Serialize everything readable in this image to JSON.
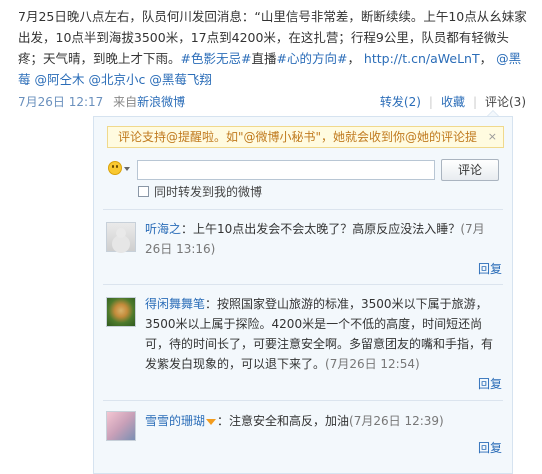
{
  "post": {
    "text_main": "7月25日晚八点左右，队员何川发回消息：“山里信号非常差，断断续续。上午10点从幺妹家出发，10点半到海拔3500米，17点到4200米，在这扎营；行程9公里，队员都有轻微头疼；天气晴，到晚上才下雨。",
    "hashtag_1": "#色影无忌#",
    "hashtag_join": "直播",
    "hashtag_2": "#心的方向#",
    "link": "http://t.cn/aWeLnT",
    "mention_1": "@黑莓",
    "mention_2": "@阿仝木",
    "mention_3": "@北京小c",
    "mention_4": "@黑莓飞翔"
  },
  "meta": {
    "time": "7月26日 12:17",
    "from_label": "来自",
    "source": "新浪微博",
    "repost": "转发(2)",
    "favorite": "收藏",
    "comment": "评论(3)"
  },
  "comment_box": {
    "tip": "评论支持@提醒啦。如\"@微博小秘书\"，她就会收到你@她的评论提",
    "tip_close": "×",
    "input_value": "",
    "submit_label": "评论",
    "also_repost_label": "同时转发到我的微博"
  },
  "comments": [
    {
      "name": "听海之",
      "text": "上午10点出发会不会太晚了？高原反应没法入睡？",
      "time": "(7月26日 13:16)",
      "reply": "回复"
    },
    {
      "name": "得闲舞舞笔",
      "text": "按照国家登山旅游的标准，3500米以下属于旅游，3500米以上属于探险。4200米是一个不低的高度，时间短还尚可，待的时间长了，可要注意安全啊。多留意团友的嘴和手指，有发紫发白现象的，可以退下来了。",
      "time": "(7月26日 12:54)",
      "reply": "回复"
    },
    {
      "name": "雪雪的珊瑚",
      "text": "注意安全和高反，加油",
      "time": "(7月26日 12:39)",
      "reply": "回复"
    }
  ],
  "colors": {
    "link": "#2b6db8",
    "panel_bg": "#f3f8fc",
    "tip_bg": "#fffbe0",
    "tip_text": "#c07a1e"
  },
  "icons": [
    "smiley-icon",
    "vip-badge-icon",
    "close-icon"
  ]
}
